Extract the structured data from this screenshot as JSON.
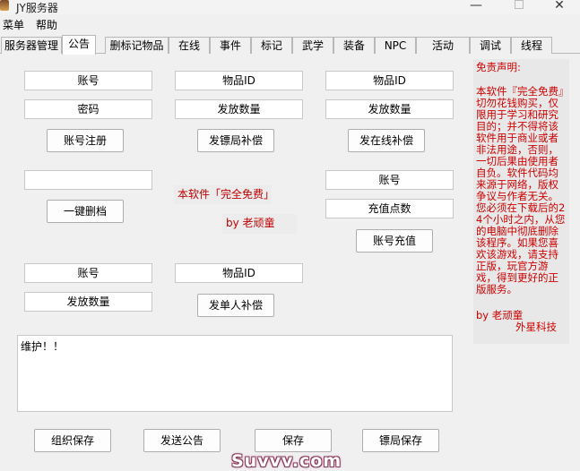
{
  "window": {
    "title": "JY服务器",
    "minimize": "—",
    "close": "✕"
  },
  "menubar": [
    "菜单",
    "帮助"
  ],
  "tabs": [
    "服务器管理",
    "公告",
    "删标记物品",
    "在线",
    "事件",
    "标记",
    "武学",
    "装备",
    "NPC",
    "活动",
    "调试",
    "线程"
  ],
  "active_tab": "公告",
  "col1": {
    "account_field": "账号",
    "password_field": "密码",
    "register_button": "账号注册",
    "empty_field": "",
    "delete_button": "一键删档",
    "account_field2": "账号",
    "quantity_field": "发放数量"
  },
  "col2": {
    "item_id_field": "物品ID",
    "quantity_field": "发放数量",
    "escort_compensate_button": "发镖局补偿",
    "free_notice": "本软件「完全免费」",
    "by_author": "by 老顽童",
    "item_id_field2": "物品ID",
    "single_compensate_button": "发单人补偿"
  },
  "col3": {
    "item_id_field": "物品ID",
    "quantity_field": "发放数量",
    "online_compensate_button": "发在线补偿",
    "account_field": "账号",
    "points_field": "充值点数",
    "recharge_button": "账号充值"
  },
  "memo": {
    "text": "维护！！"
  },
  "bottom_buttons": {
    "guild_save": "组织保存",
    "send_notice": "发送公告",
    "save": "保存",
    "escort_save": "镖局保存"
  },
  "disclaimer": {
    "title": "免责声明:",
    "body": "本软件『完全免费』切勿花钱购买，仅限用于学习和研究目的；并不得将该软件用于商业或者非法用途，否则，一切后果由使用者自负。软件代码均来源于网络，版权争议与作者无关。您必须在下载后的24个小时之内，从您的电脑中彻底删除该程序。如果您喜欢该游戏，请支持正版，玩官方游戏，得到更好的正版服务。",
    "author": "by 老顽童",
    "company": "外星科技"
  },
  "watermark": "Suvvv.com",
  "colors": {
    "red_text": "#cc0000",
    "background": "#f0f0f0"
  }
}
